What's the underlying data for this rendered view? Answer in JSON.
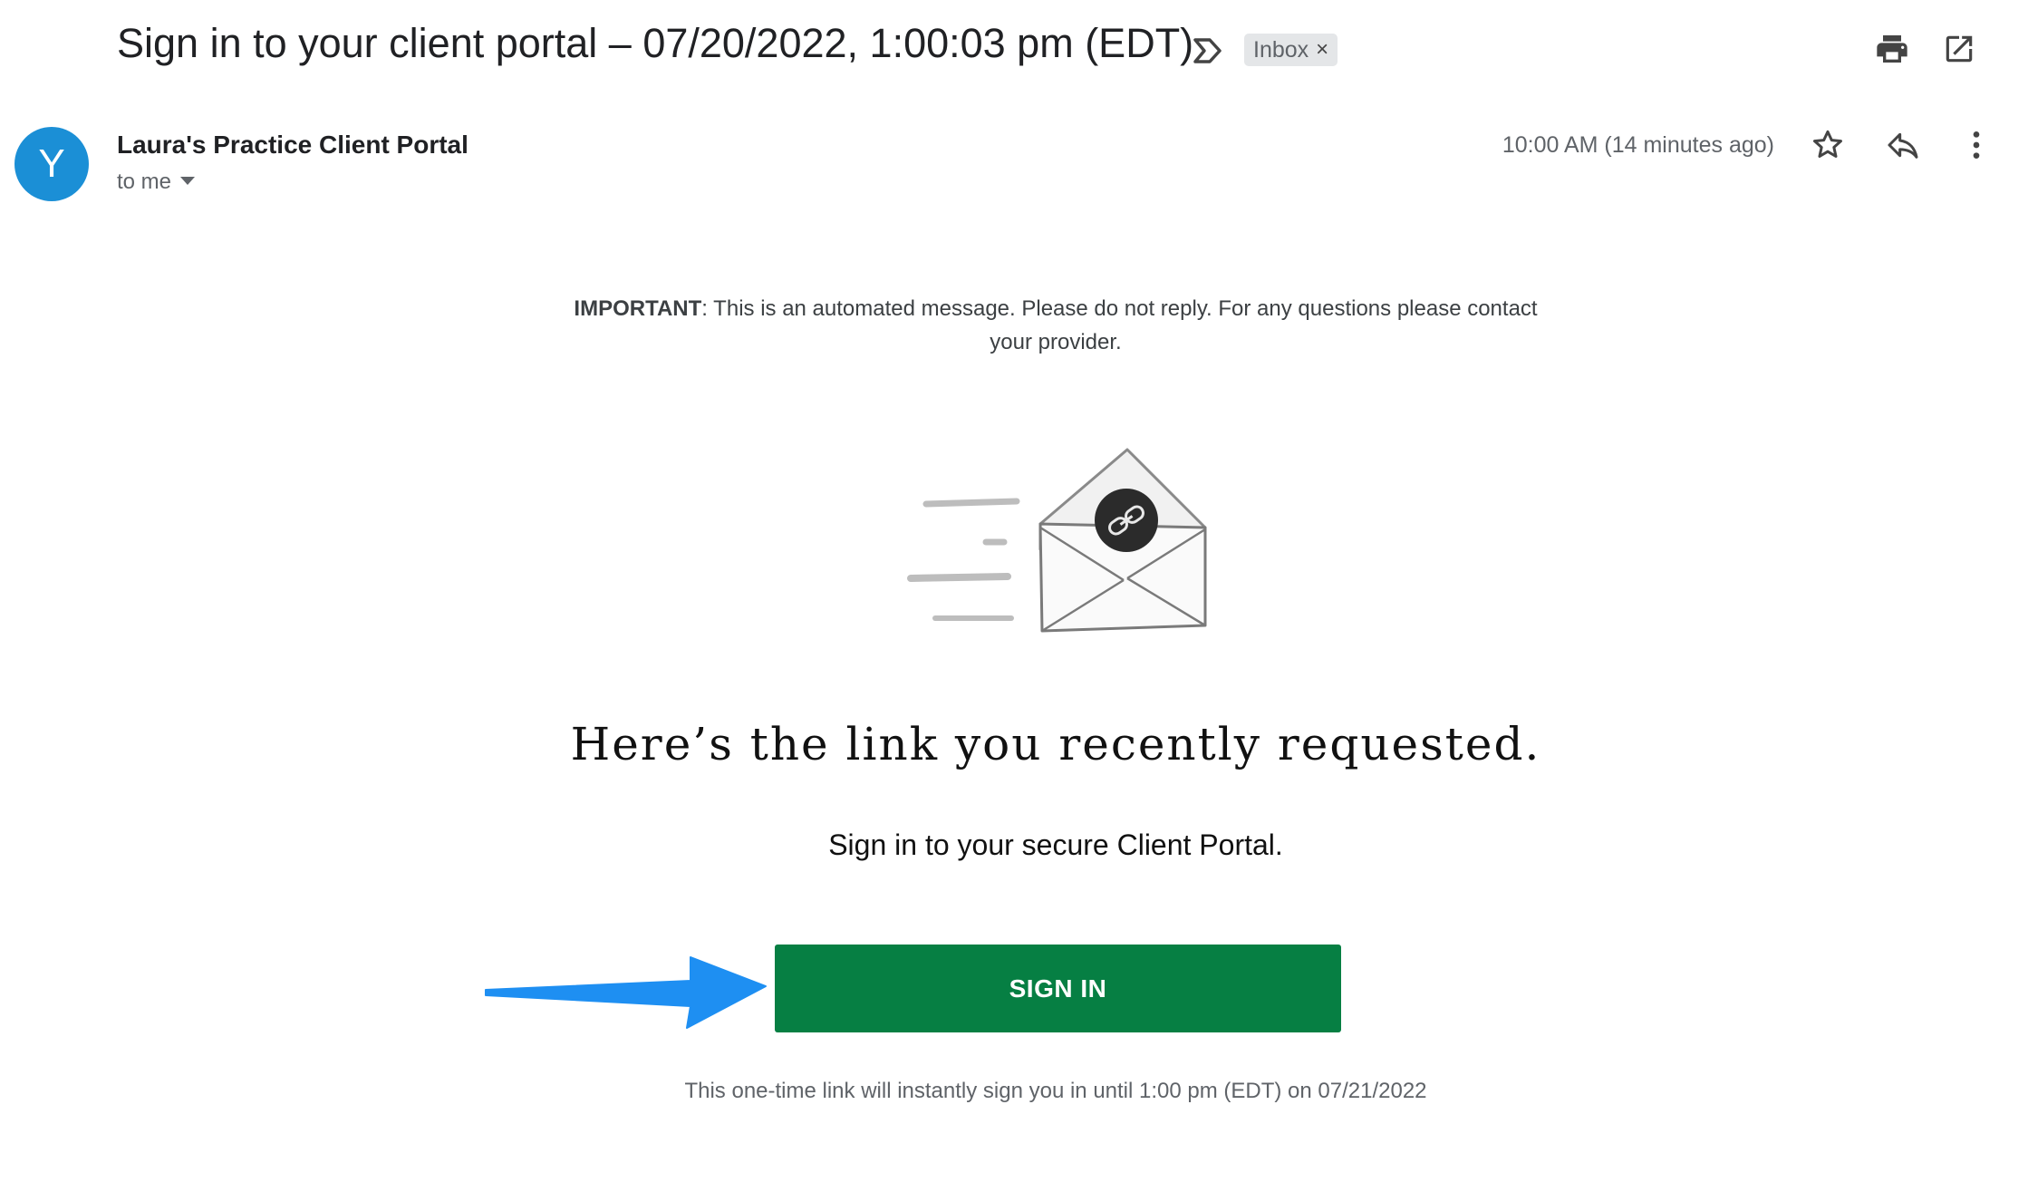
{
  "email": {
    "subject": "Sign in to your client portal – 07/20/2022, 1:00:03 pm (EDT)",
    "label": "Inbox",
    "label_remove": "×",
    "avatar_letter": "Y",
    "sender": "Laura's Practice Client Portal",
    "recipient": "to me",
    "timestamp": "10:00 AM (14 minutes ago)"
  },
  "icons": {
    "important": "label-important-icon",
    "print": "print-icon",
    "open_new_window": "open-in-new-window-icon",
    "star": "star-icon",
    "reply": "reply-icon",
    "more": "more-vert-icon",
    "illustration": "envelope-link-icon",
    "arrow": "arrow-right-icon"
  },
  "message": {
    "important_bold": "IMPORTANT",
    "important_text": ": This is an automated message. Please do not reply. For any questions please contact your provider.",
    "headline": "Here’s the link you recently requested.",
    "subline": "Sign in to your secure Client Portal.",
    "button_label": "SIGN IN",
    "expiry_note": "This one-time link will instantly sign you in until 1:00 pm (EDT) on 07/21/2022"
  },
  "colors": {
    "button": "#067f43",
    "avatar": "#1b8fd6",
    "arrow": "#1e8ff2",
    "label_chip": "#e4e6e8"
  }
}
